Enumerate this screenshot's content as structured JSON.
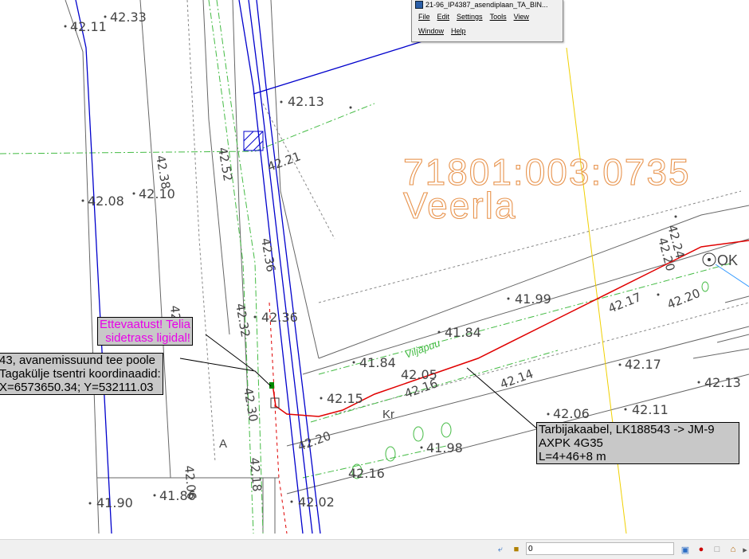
{
  "window": {
    "title": "21-96_IP4387_asendiplaan_TA_BIN...",
    "menu": [
      "File",
      "Edit",
      "Settings",
      "Tools",
      "View",
      "Window",
      "Help"
    ]
  },
  "parcel": {
    "id": "71801:003:0735",
    "name": "Veerla"
  },
  "elevations": [
    "42.33",
    "42.11",
    "42.13",
    "42.21",
    "42.52",
    "42.38",
    "42.10",
    "42.08",
    "42.32",
    "42.36",
    "42.32",
    "42.30",
    "42.18",
    "42.20",
    "42.15",
    "42.05",
    "42.16",
    "41.84",
    "41.84",
    "41.99",
    "42.14",
    "42.06",
    "42.11",
    "42.17",
    "42.13",
    "42.17",
    "42.20",
    "42.24",
    "42.20",
    "42.02",
    "42.16",
    "41.98",
    "41.90",
    "41.86",
    "42.06",
    "42"
  ],
  "labels": {
    "street": "Viljapuu",
    "kr": "Kr",
    "a": "A",
    "ok": "OK"
  },
  "callouts": {
    "warning": [
      "Ettevaatust! Telia",
      "sidetrass ligidal!"
    ],
    "point": [
      "43, avanemissuund tee poole",
      "Tagakülje tsentri koordinaadid:",
      "X=6573650.34; Y=532111.03"
    ],
    "cable": [
      "Tarbijakaabel, LK188543 -> JM-9",
      "AXPK 4G35",
      "L=4+46+8 m"
    ]
  },
  "status": {
    "coordinate_value": "0"
  },
  "colors": {
    "road": "#0000cc",
    "cable": "#e00000",
    "green": "#44bb44",
    "parcel_text": "#e8944e",
    "warning_text": "#e800e8"
  }
}
